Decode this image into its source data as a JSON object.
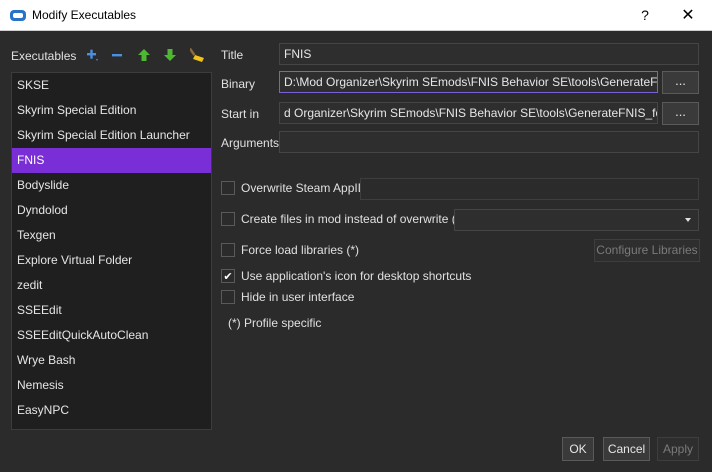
{
  "window": {
    "title": "Modify Executables",
    "help_label": "?",
    "close_label": "✕"
  },
  "executables": {
    "label": "Executables",
    "items": [
      "SKSE",
      "Skyrim Special Edition",
      "Skyrim Special Edition Launcher",
      "FNIS",
      "Bodyslide",
      "Dyndolod",
      "Texgen",
      "Explore Virtual Folder",
      "zedit",
      "SSEEdit",
      "SSEEditQuickAutoClean",
      "Wrye Bash",
      "Nemesis",
      "EasyNPC"
    ],
    "selected": "FNIS"
  },
  "form": {
    "title_label": "Title",
    "title_value": "FNIS",
    "binary_label": "Binary",
    "binary_value": "D:\\Mod Organizer\\Skyrim SEmods\\FNIS Behavior SE\\tools\\GenerateFNIS_for_",
    "start_in_label": "Start in",
    "start_in_value": "d Organizer\\Skyrim SEmods\\FNIS Behavior SE\\tools\\GenerateFNIS_for_Users",
    "arguments_label": "Arguments",
    "arguments_value": "",
    "browse_label": "..."
  },
  "options": {
    "overwrite_steam_appid": {
      "label": "Overwrite Steam AppID",
      "checked": false
    },
    "create_files_in_mod": {
      "label": "Create files in mod instead of overwrite (*)",
      "checked": false
    },
    "force_load_libraries": {
      "label": "Force load libraries (*)",
      "checked": false
    },
    "use_app_icon": {
      "label": "Use application's icon for desktop shortcuts",
      "checked": true
    },
    "hide_in_ui": {
      "label": "Hide in user interface",
      "checked": false
    },
    "configure_libraries_label": "Configure Libraries",
    "profile_note": "(*) Profile specific"
  },
  "buttons": {
    "ok": "OK",
    "cancel": "Cancel",
    "apply": "Apply"
  },
  "colors": {
    "accent": "#7a2fd6",
    "background": "#2b2b2b"
  }
}
